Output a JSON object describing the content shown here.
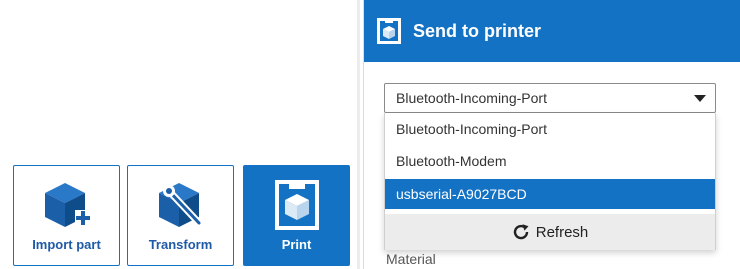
{
  "toolbar": {
    "buttons": [
      {
        "label": "Import part",
        "icon": "import-part-icon"
      },
      {
        "label": "Transform",
        "icon": "transform-icon"
      },
      {
        "label": "Print",
        "icon": "print-icon",
        "active": true
      }
    ]
  },
  "panel": {
    "title": "Send to printer",
    "header_icon": "printer-icon",
    "port_select": {
      "selected": "Bluetooth-Incoming-Port",
      "options": [
        "Bluetooth-Incoming-Port",
        "Bluetooth-Modem",
        "usbserial-A9027BCD"
      ],
      "highlighted_option": "usbserial-A9027BCD"
    },
    "refresh_label": "Refresh",
    "refresh_icon": "refresh-icon",
    "material_label": "Material"
  },
  "colors": {
    "accent": "#1472c4",
    "header_text": "#ffffff",
    "button_label": "#1f5aa8",
    "refresh_bg": "#ececec"
  }
}
